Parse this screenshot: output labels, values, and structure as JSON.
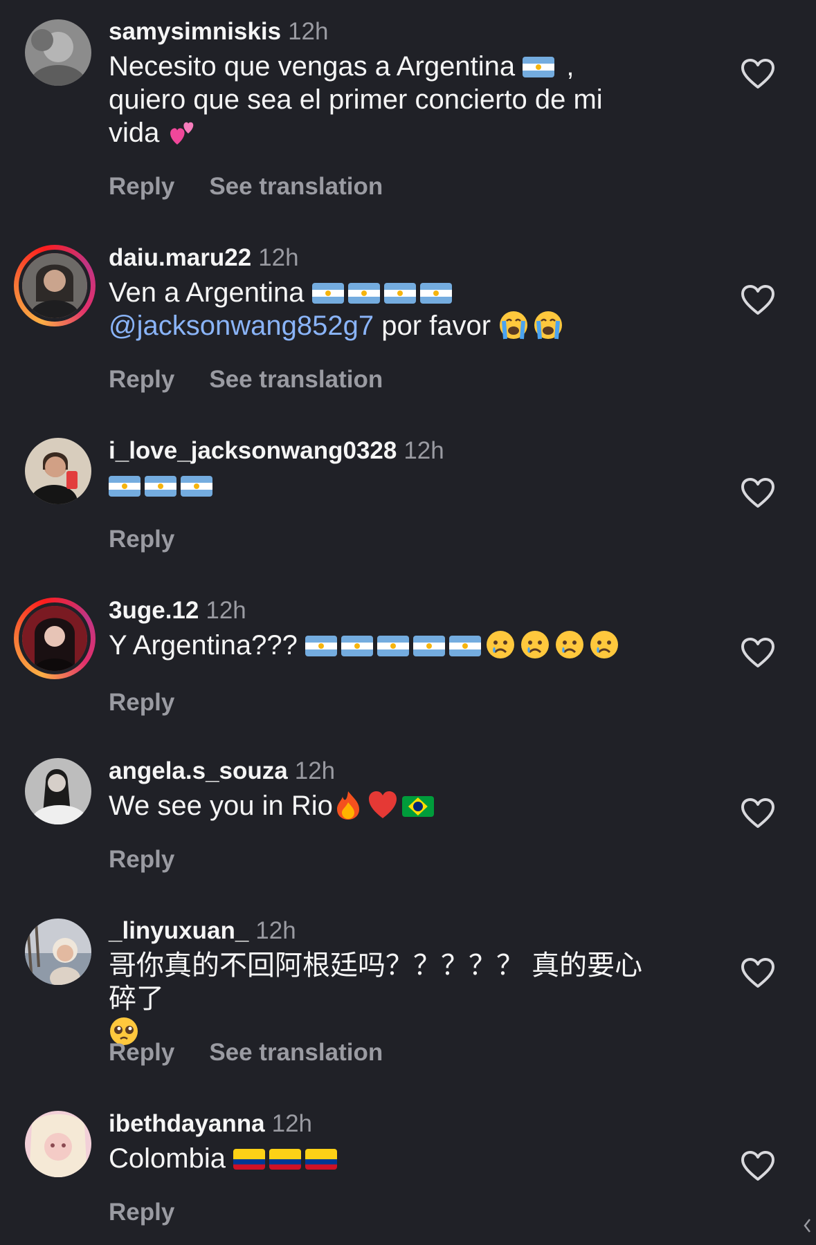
{
  "comments": [
    {
      "username": "samysimniskis",
      "time": "12h",
      "text_parts": [
        "Necesito que vengas a Argentina",
        ",",
        "quiero que sea el primer concierto de mi",
        "vida"
      ],
      "reply_label": "Reply",
      "translation_label": "See translation"
    },
    {
      "username": "daiu.maru22",
      "time": "12h",
      "text_parts": [
        "Ven a Argentina",
        "@jacksonwang852g7",
        "por favor"
      ],
      "reply_label": "Reply",
      "translation_label": "See translation"
    },
    {
      "username": "i_love_jacksonwang0328",
      "time": "12h",
      "reply_label": "Reply"
    },
    {
      "username": "3uge.12",
      "time": "12h",
      "text_parts": [
        "Y Argentina???"
      ],
      "reply_label": "Reply"
    },
    {
      "username": "angela.s_souza",
      "time": "12h",
      "text_parts": [
        "We see you in Rio"
      ],
      "reply_label": "Reply"
    },
    {
      "username": "_linyuxuan_",
      "time": "12h",
      "text_parts": [
        "哥你真的不回阿根廷吗？？？？？ 真的要心碎了"
      ],
      "reply_label": "Reply",
      "translation_label": "See translation"
    },
    {
      "username": "ibethdayanna",
      "time": "12h",
      "text_parts": [
        "Colombia"
      ],
      "reply_label": "Reply"
    }
  ],
  "colors": {
    "background": "#202127",
    "text": "#f5f5f5",
    "muted": "#9a9ba2",
    "mention": "#8ab4f8"
  }
}
